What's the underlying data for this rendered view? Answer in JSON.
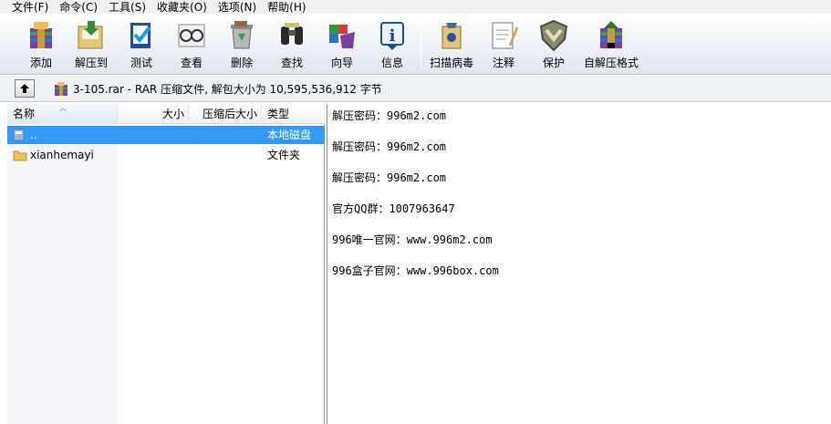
{
  "menu": [
    "文件(F)",
    "命令(C)",
    "工具(S)",
    "收藏夹(O)",
    "选项(N)",
    "帮助(H)"
  ],
  "toolbar": {
    "buttons": [
      {
        "label": "添加",
        "icon": "archive-add-icon"
      },
      {
        "label": "解压到",
        "icon": "extract-folder-icon"
      },
      {
        "label": "测试",
        "icon": "test-check-icon"
      },
      {
        "label": "查看",
        "icon": "view-glasses-icon"
      },
      {
        "label": "删除",
        "icon": "delete-recycle-icon"
      },
      {
        "label": "查找",
        "icon": "find-binoculars-icon"
      },
      {
        "label": "向导",
        "icon": "wizard-icon"
      },
      {
        "label": "信息",
        "icon": "info-icon"
      },
      {
        "label": "扫描病毒",
        "icon": "virus-scan-icon"
      },
      {
        "label": "注释",
        "icon": "comment-note-icon"
      },
      {
        "label": "保护",
        "icon": "protect-shield-icon"
      },
      {
        "label": "自解压格式",
        "icon": "sfx-archive-icon"
      }
    ]
  },
  "address": {
    "text": "3-105.rar - RAR 压缩文件, 解包大小为 10,595,536,912 字节"
  },
  "filelist": {
    "columns": {
      "name": "名称",
      "size": "大小",
      "packed": "压缩后大小",
      "type": "类型"
    },
    "rows": [
      {
        "name": "..",
        "size": "",
        "packed": "",
        "type": "本地磁盘",
        "selected": true
      },
      {
        "name": "xianhemayi",
        "size": "",
        "packed": "",
        "type": "文件夹",
        "selected": false
      }
    ]
  },
  "comment": {
    "lines": [
      "解压密码：996m2.com",
      "解压密码：996m2.com",
      "解压密码：996m2.com",
      "官方QQ群：1007963647",
      "996唯一官网：www.996m2.com",
      "996盒子官网：www.996box.com"
    ]
  },
  "colors": {
    "selection": "#3399ff",
    "toolbar_bg": "#eef2f8"
  }
}
